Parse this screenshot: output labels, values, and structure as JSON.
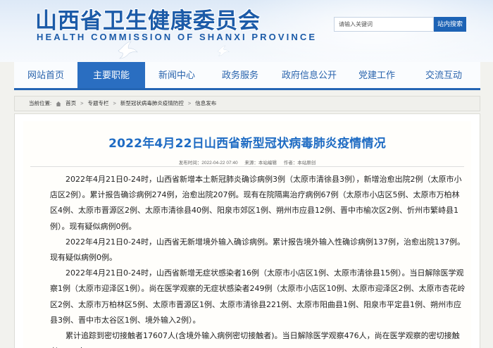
{
  "site": {
    "title_cn": "山西省卫生健康委员会",
    "title_en": "HEALTH COMMISSION OF SHANXI PROVINCE"
  },
  "search": {
    "placeholder": "请输入关键词",
    "button_label": "站内搜索"
  },
  "nav": {
    "items": [
      {
        "label": "网站首页",
        "active": false
      },
      {
        "label": "主要职能",
        "active": true
      },
      {
        "label": "新闻中心",
        "active": false
      },
      {
        "label": "政务服务",
        "active": false
      },
      {
        "label": "政府信息公开",
        "active": false
      },
      {
        "label": "党建工作",
        "active": false
      },
      {
        "label": "交流互动",
        "active": false
      }
    ]
  },
  "breadcrumb": {
    "prefix": "当前位置:",
    "items": [
      "首页",
      "专题专栏",
      "新型冠状病毒肺炎疫情防控",
      "信息发布"
    ],
    "separator": ">"
  },
  "article": {
    "title": "2022年4月22日山西省新型冠状病毒肺炎疫情情况",
    "publish_time": "发布时间：2022-04-22 07:40",
    "source": "来源：本站编辑",
    "author": "作者：本站原创",
    "paragraphs": [
      "2022年4月21日0-24时，山西省新增本土新冠肺炎确诊病例3例（太原市清徐县3例），新增治愈出院2例（太原市小店区2例）。累计报告确诊病例274例，治愈出院207例。现有在院隔离治疗病例67例（太原市小店区5例、太原市万柏林区4例、太原市晋源区2例、太原市清徐县40例、阳泉市郊区1例、朔州市应县12例、晋中市榆次区2例、忻州市繁峙县1例）。现有疑似病例0例。",
      "2022年4月21日0-24时，山西省无新增境外输入确诊病例。累计报告境外输入性确诊病例137例，治愈出院137例。现有疑似病例0例。",
      "2022年4月21日0-24时，山西省新增无症状感染者16例（太原市小店区1例、太原市清徐县15例）。当日解除医学观察1例（太原市迎泽区1例）。尚在医学观察的无症状感染者249例（太原市小店区10例、太原市迎泽区2例、太原市杏花岭区2例、太原市万柏林区5例、太原市晋源区1例、太原市清徐县221例、太原市阳曲县1例、阳泉市平定县1例、朔州市应县3例、晋中市太谷区1例、境外输入2例）。",
      "累计追踪到密切接触者17607人(含境外输入病例密切接触者)。当日解除医学观察476人，尚在医学观察的密切接触者3599人。"
    ]
  },
  "colors": {
    "brand_blue": "#1c5ba8",
    "nav_active_bg": "#2a6ec1",
    "title_blue": "#1e6bc3"
  }
}
